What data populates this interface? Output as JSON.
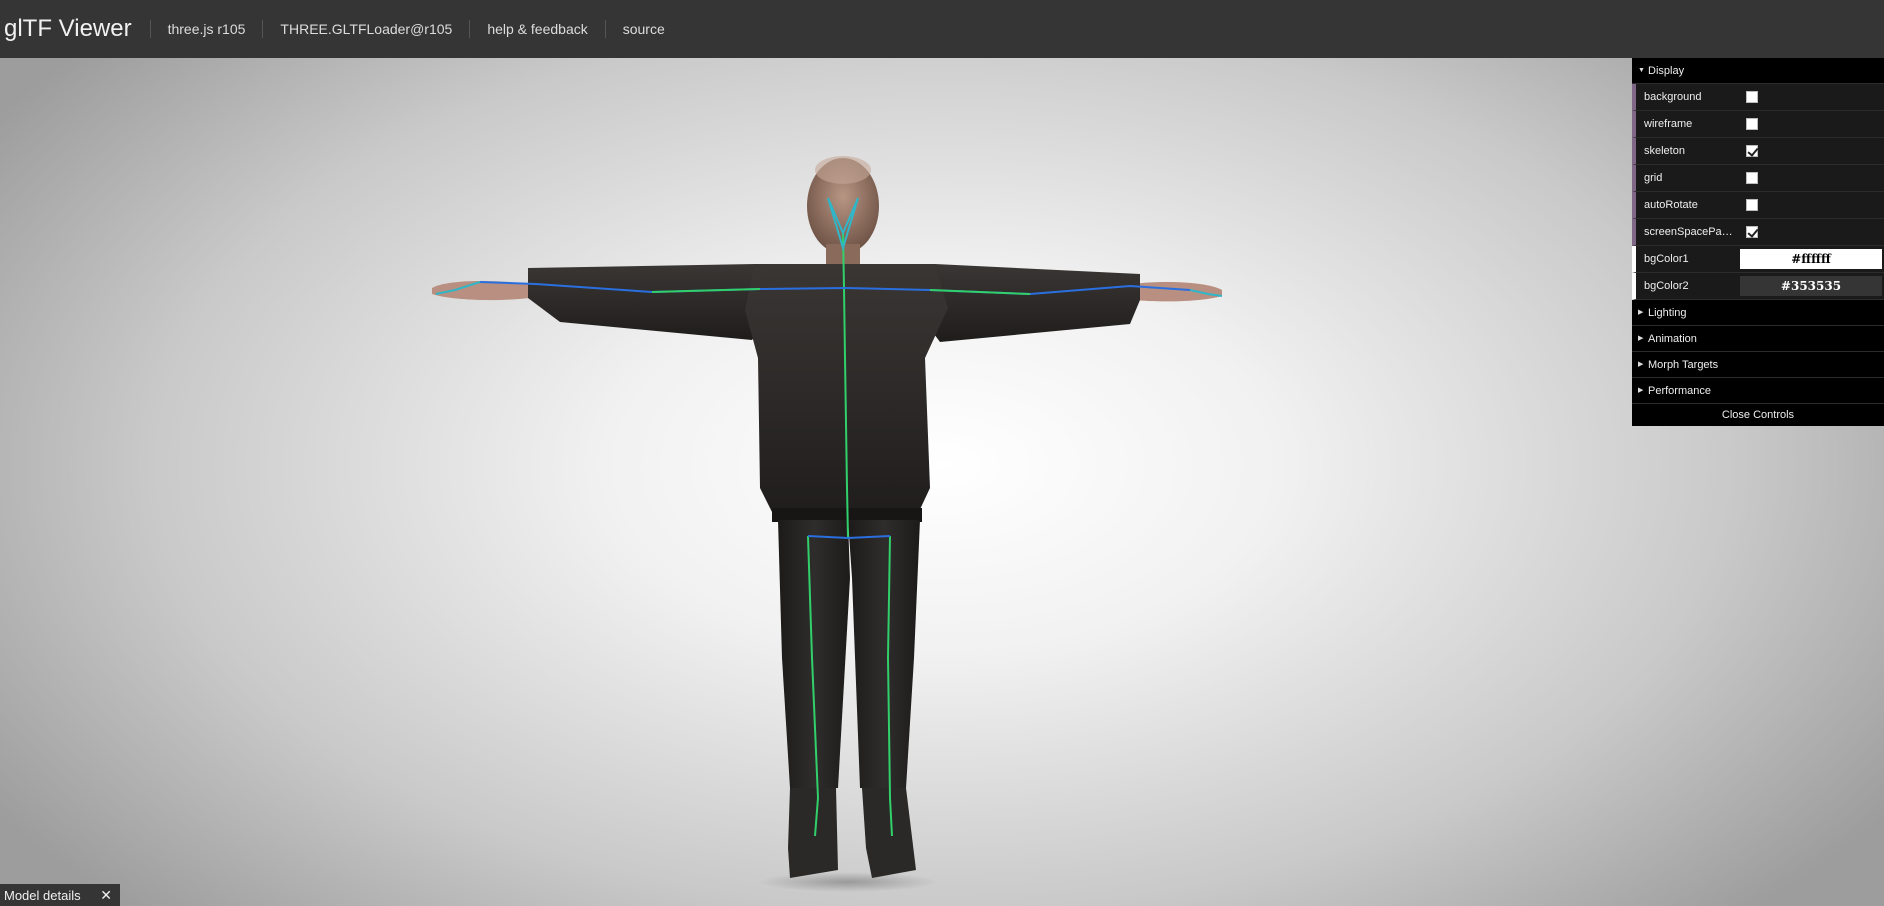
{
  "header": {
    "title": "glTF Viewer",
    "links": [
      "three.js r105",
      "THREE.GLTFLoader@r105",
      "help & feedback",
      "source"
    ]
  },
  "controls": {
    "display_folder": "Display",
    "rows": [
      {
        "label": "background",
        "checked": false
      },
      {
        "label": "wireframe",
        "checked": false
      },
      {
        "label": "skeleton",
        "checked": true
      },
      {
        "label": "grid",
        "checked": false
      },
      {
        "label": "autoRotate",
        "checked": false
      },
      {
        "label": "screenSpacePan…",
        "checked": true
      }
    ],
    "colors": [
      {
        "label": "bgColor1",
        "value": "#ffffff"
      },
      {
        "label": "bgColor2",
        "value": "#353535"
      }
    ],
    "folders": [
      "Lighting",
      "Animation",
      "Morph Targets",
      "Performance"
    ],
    "close_label": "Close Controls"
  },
  "footer": {
    "details_label": "Model details",
    "close_glyph": "✕"
  },
  "icons": {
    "folder_open": "triangle-down-icon",
    "folder_closed": "triangle-right-icon"
  }
}
